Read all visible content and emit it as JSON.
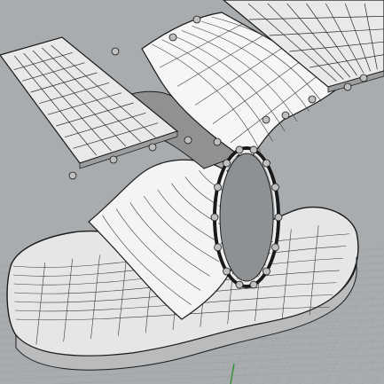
{
  "viewport": {
    "view_type": "perspective",
    "display_mode": "shaded-wireframe",
    "grid_visible": true,
    "object_name": ""
  },
  "colors": {
    "background": "#a9acae",
    "grid_line": "#9ea1a4",
    "surface_light": "#f2f2f2",
    "surface_mid": "#d9d9d9",
    "surface_shadow": "#8f9193",
    "isocurve": "#3a3a3a",
    "edge": "#1a1a1a",
    "control_point": "#bfbfbf",
    "axis_green": "#2f8f2f"
  },
  "scene": {
    "objects": [
      {
        "name": "solar-panel-left",
        "type": "panel-grid"
      },
      {
        "name": "solar-panel-right",
        "type": "panel-grid"
      },
      {
        "name": "upper-curved-strip",
        "type": "nurbs-surface"
      },
      {
        "name": "lower-curved-strip",
        "type": "nurbs-surface"
      },
      {
        "name": "round-frame",
        "type": "ring"
      },
      {
        "name": "base-pad",
        "type": "nurbs-surface"
      }
    ]
  }
}
